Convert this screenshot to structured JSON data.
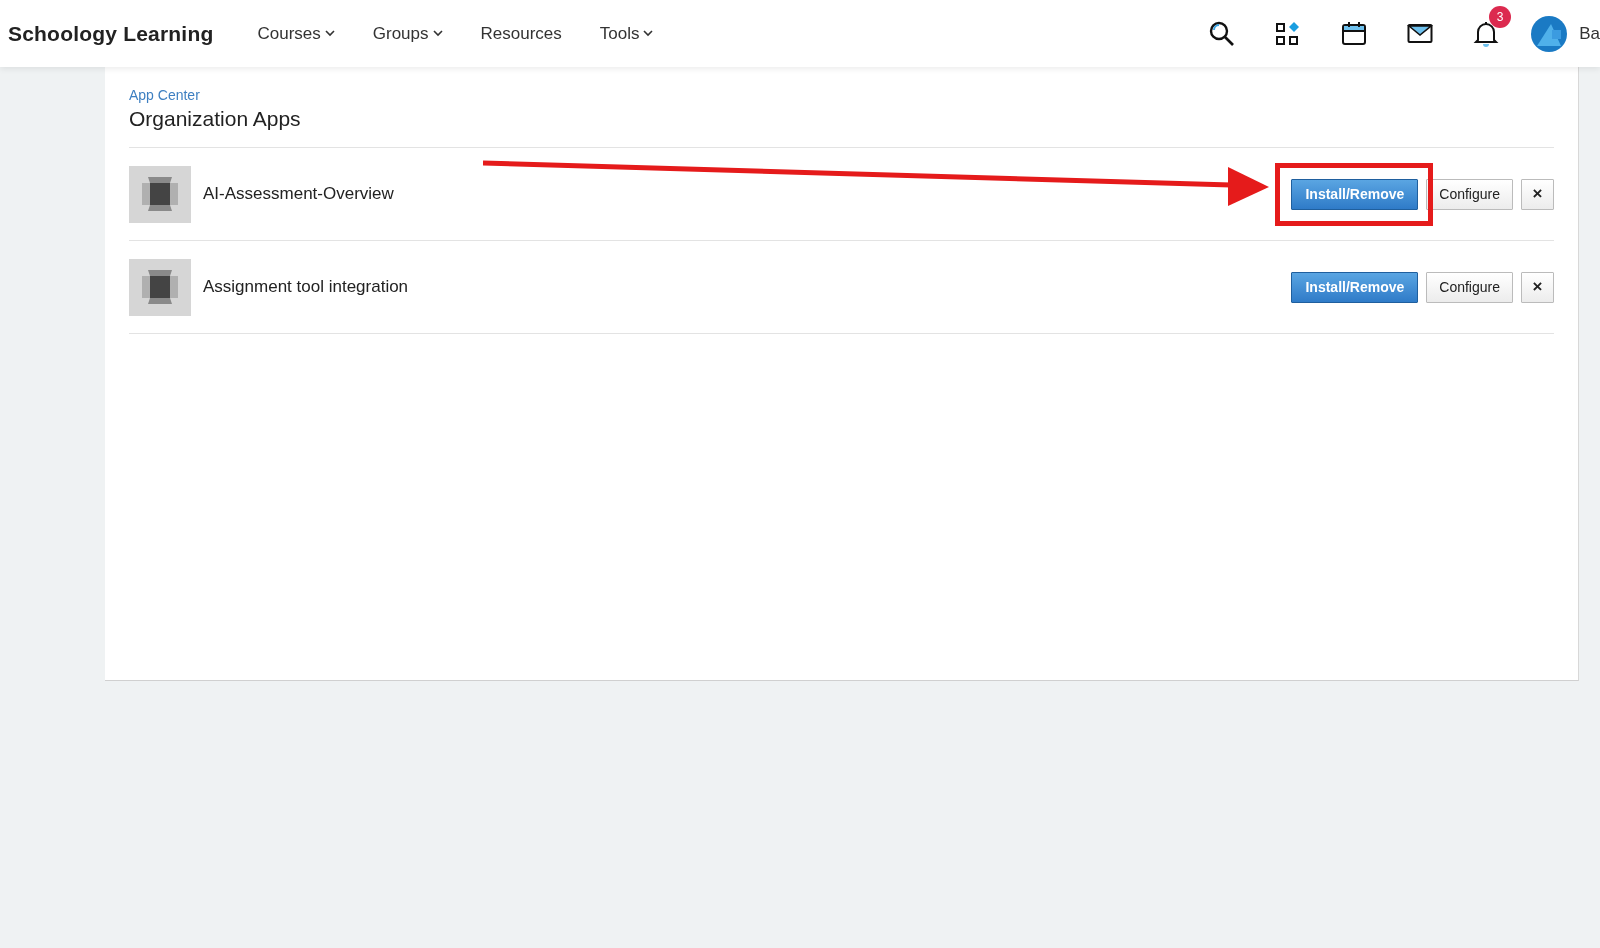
{
  "header": {
    "logo": "Schoology Learning",
    "nav": [
      {
        "label": "Courses",
        "dropdown": true
      },
      {
        "label": "Groups",
        "dropdown": true
      },
      {
        "label": "Resources",
        "dropdown": false
      },
      {
        "label": "Tools",
        "dropdown": true
      }
    ],
    "notification_count": "3",
    "user_name": "Ba"
  },
  "breadcrumb": "App Center",
  "title": "Organization Apps",
  "apps": [
    {
      "name": "AI-Assessment-Overview",
      "highlighted": true,
      "buttons": [
        {
          "label": "Install/Remove",
          "kind": "primary"
        },
        {
          "label": "Configure",
          "kind": "secondary"
        },
        {
          "label": "×",
          "kind": "remove"
        }
      ]
    },
    {
      "name": "Assignment tool integration",
      "highlighted": false,
      "buttons": [
        {
          "label": "Install/Remove",
          "kind": "primary"
        },
        {
          "label": "Configure",
          "kind": "secondary"
        },
        {
          "label": "×",
          "kind": "remove"
        }
      ]
    }
  ]
}
